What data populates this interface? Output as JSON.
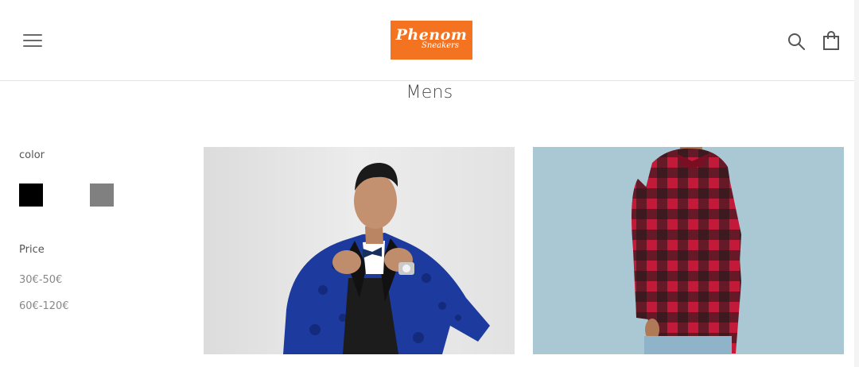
{
  "header": {
    "logo_main": "Phenom",
    "logo_sub": "Sneakers",
    "menu_icon": "hamburger-icon",
    "search_icon": "search-icon",
    "cart_icon": "shopping-bag-icon",
    "logo_color": "#f47321"
  },
  "page": {
    "title": "Mens"
  },
  "filters": {
    "color_heading": "color",
    "colors": [
      {
        "name": "black",
        "hex": "#000000"
      },
      {
        "name": "gray",
        "hex": "#808080"
      }
    ],
    "price_heading": "Price",
    "price_options": [
      "30€-50€",
      "60€-120€"
    ]
  },
  "products": [
    {
      "image": "man-in-blue-tuxedo-jacket"
    },
    {
      "image": "man-in-red-plaid-shirt"
    }
  ]
}
